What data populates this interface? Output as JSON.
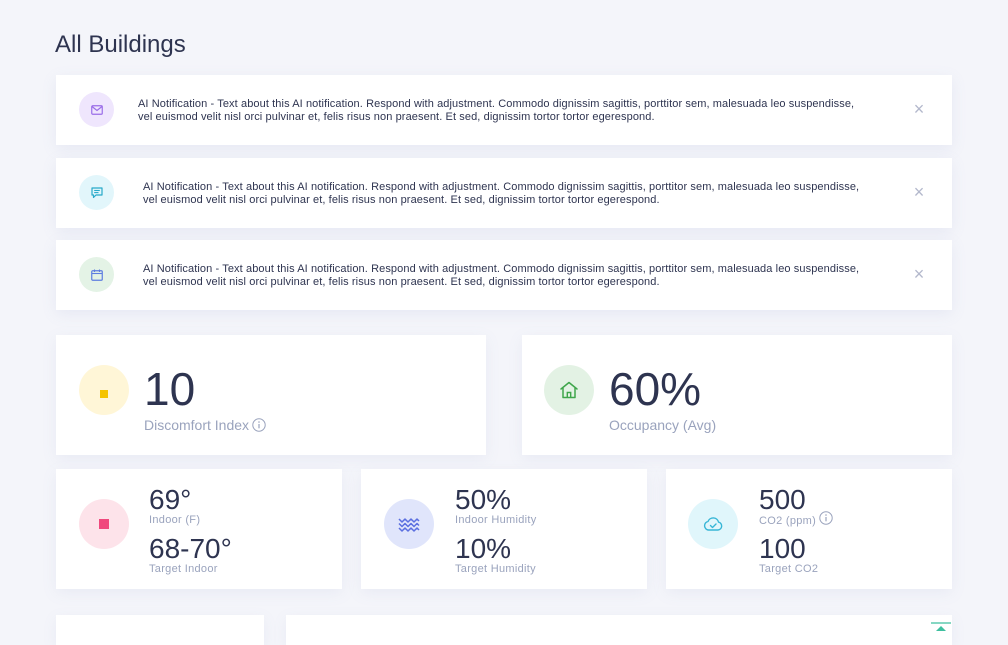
{
  "page": {
    "title": "All Buildings"
  },
  "notifications": [
    {
      "text": "AI Notification - Text about this AI notification. Respond with adjustment. Commodo dignissim sagittis, porttitor sem, malesuada leo suspendisse, vel euismod velit nisl orci pulvinar et, felis risus non praesent. Et sed, dignissim tortor tortor egerespond.",
      "icon": "mail-icon",
      "color": "#9b6ee8",
      "bg": "#efe6fd"
    },
    {
      "text": "AI Notification - Text about this AI notification. Respond with adjustment. Commodo dignissim sagittis, porttitor sem, malesuada leo suspendisse, vel euismod velit nisl orci pulvinar et, felis risus non praesent. Et sed, dignissim tortor tortor egerespond.",
      "icon": "message-icon",
      "color": "#27a9c9",
      "bg": "#e2f6fb"
    },
    {
      "text": "AI Notification - Text about this AI notification. Respond with adjustment. Commodo dignissim sagittis, porttitor sem, malesuada leo suspendisse, vel euismod velit nisl orci pulvinar et, felis risus non praesent. Et sed, dignissim tortor tortor egerespond.",
      "icon": "calendar-icon",
      "color": "#5d7de0",
      "bg": "#e4f3e6"
    }
  ],
  "close_symbol": "×",
  "discomfort": {
    "value": "10",
    "label": "Discomfort Index",
    "color": "#f5c400",
    "bg": "#fff6d7"
  },
  "occupancy": {
    "value": "60%",
    "label": "Occupancy (Avg)",
    "color": "#3fa64b",
    "bg": "#e3f2e4"
  },
  "temperature": {
    "indoor_value": "69°",
    "indoor_label": "Indoor (F)",
    "target_value": "68-70°",
    "target_label": "Target Indoor",
    "color": "#f0487d",
    "bg": "#fde3ea"
  },
  "humidity": {
    "indoor_value": "50%",
    "indoor_label": "Indoor Humidity",
    "target_value": "10%",
    "target_label": "Target Humidity",
    "color": "#5b6fe0",
    "bg": "#e0e5fb"
  },
  "co2": {
    "indoor_value": "500",
    "indoor_label": "CO2 (ppm)",
    "target_value": "100",
    "target_label": "Target CO2",
    "color": "#37b6d6",
    "bg": "#e0f6fb"
  }
}
